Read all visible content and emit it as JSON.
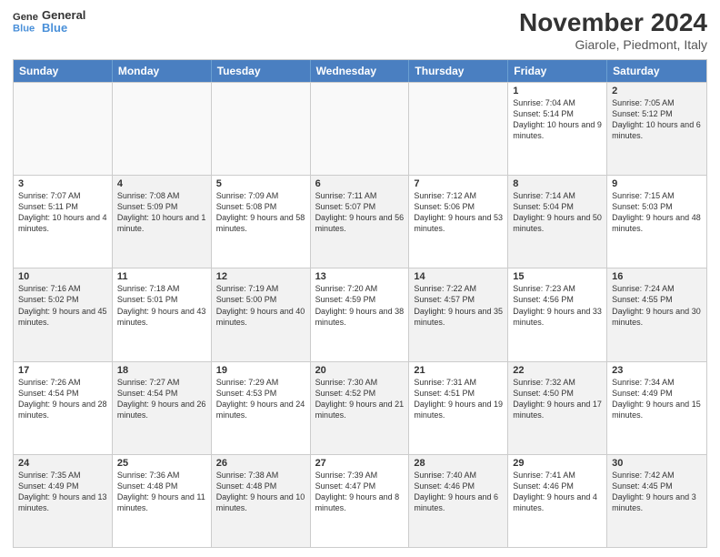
{
  "logo": {
    "line1": "General",
    "line2": "Blue"
  },
  "title": "November 2024",
  "subtitle": "Giarole, Piedmont, Italy",
  "days": [
    "Sunday",
    "Monday",
    "Tuesday",
    "Wednesday",
    "Thursday",
    "Friday",
    "Saturday"
  ],
  "weeks": [
    [
      {
        "day": "",
        "info": "",
        "empty": true
      },
      {
        "day": "",
        "info": "",
        "empty": true
      },
      {
        "day": "",
        "info": "",
        "empty": true
      },
      {
        "day": "",
        "info": "",
        "empty": true
      },
      {
        "day": "",
        "info": "",
        "empty": true
      },
      {
        "day": "1",
        "info": "Sunrise: 7:04 AM\nSunset: 5:14 PM\nDaylight: 10 hours\nand 9 minutes."
      },
      {
        "day": "2",
        "info": "Sunrise: 7:05 AM\nSunset: 5:12 PM\nDaylight: 10 hours\nand 6 minutes.",
        "shaded": true
      }
    ],
    [
      {
        "day": "3",
        "info": "Sunrise: 7:07 AM\nSunset: 5:11 PM\nDaylight: 10 hours\nand 4 minutes."
      },
      {
        "day": "4",
        "info": "Sunrise: 7:08 AM\nSunset: 5:09 PM\nDaylight: 10 hours\nand 1 minute.",
        "shaded": true
      },
      {
        "day": "5",
        "info": "Sunrise: 7:09 AM\nSunset: 5:08 PM\nDaylight: 9 hours\nand 58 minutes."
      },
      {
        "day": "6",
        "info": "Sunrise: 7:11 AM\nSunset: 5:07 PM\nDaylight: 9 hours\nand 56 minutes.",
        "shaded": true
      },
      {
        "day": "7",
        "info": "Sunrise: 7:12 AM\nSunset: 5:06 PM\nDaylight: 9 hours\nand 53 minutes."
      },
      {
        "day": "8",
        "info": "Sunrise: 7:14 AM\nSunset: 5:04 PM\nDaylight: 9 hours\nand 50 minutes.",
        "shaded": true
      },
      {
        "day": "9",
        "info": "Sunrise: 7:15 AM\nSunset: 5:03 PM\nDaylight: 9 hours\nand 48 minutes."
      }
    ],
    [
      {
        "day": "10",
        "info": "Sunrise: 7:16 AM\nSunset: 5:02 PM\nDaylight: 9 hours\nand 45 minutes.",
        "shaded": true
      },
      {
        "day": "11",
        "info": "Sunrise: 7:18 AM\nSunset: 5:01 PM\nDaylight: 9 hours\nand 43 minutes."
      },
      {
        "day": "12",
        "info": "Sunrise: 7:19 AM\nSunset: 5:00 PM\nDaylight: 9 hours\nand 40 minutes.",
        "shaded": true
      },
      {
        "day": "13",
        "info": "Sunrise: 7:20 AM\nSunset: 4:59 PM\nDaylight: 9 hours\nand 38 minutes."
      },
      {
        "day": "14",
        "info": "Sunrise: 7:22 AM\nSunset: 4:57 PM\nDaylight: 9 hours\nand 35 minutes.",
        "shaded": true
      },
      {
        "day": "15",
        "info": "Sunrise: 7:23 AM\nSunset: 4:56 PM\nDaylight: 9 hours\nand 33 minutes."
      },
      {
        "day": "16",
        "info": "Sunrise: 7:24 AM\nSunset: 4:55 PM\nDaylight: 9 hours\nand 30 minutes.",
        "shaded": true
      }
    ],
    [
      {
        "day": "17",
        "info": "Sunrise: 7:26 AM\nSunset: 4:54 PM\nDaylight: 9 hours\nand 28 minutes."
      },
      {
        "day": "18",
        "info": "Sunrise: 7:27 AM\nSunset: 4:54 PM\nDaylight: 9 hours\nand 26 minutes.",
        "shaded": true
      },
      {
        "day": "19",
        "info": "Sunrise: 7:29 AM\nSunset: 4:53 PM\nDaylight: 9 hours\nand 24 minutes."
      },
      {
        "day": "20",
        "info": "Sunrise: 7:30 AM\nSunset: 4:52 PM\nDaylight: 9 hours\nand 21 minutes.",
        "shaded": true
      },
      {
        "day": "21",
        "info": "Sunrise: 7:31 AM\nSunset: 4:51 PM\nDaylight: 9 hours\nand 19 minutes."
      },
      {
        "day": "22",
        "info": "Sunrise: 7:32 AM\nSunset: 4:50 PM\nDaylight: 9 hours\nand 17 minutes.",
        "shaded": true
      },
      {
        "day": "23",
        "info": "Sunrise: 7:34 AM\nSunset: 4:49 PM\nDaylight: 9 hours\nand 15 minutes."
      }
    ],
    [
      {
        "day": "24",
        "info": "Sunrise: 7:35 AM\nSunset: 4:49 PM\nDaylight: 9 hours\nand 13 minutes.",
        "shaded": true
      },
      {
        "day": "25",
        "info": "Sunrise: 7:36 AM\nSunset: 4:48 PM\nDaylight: 9 hours\nand 11 minutes."
      },
      {
        "day": "26",
        "info": "Sunrise: 7:38 AM\nSunset: 4:48 PM\nDaylight: 9 hours\nand 10 minutes.",
        "shaded": true
      },
      {
        "day": "27",
        "info": "Sunrise: 7:39 AM\nSunset: 4:47 PM\nDaylight: 9 hours\nand 8 minutes."
      },
      {
        "day": "28",
        "info": "Sunrise: 7:40 AM\nSunset: 4:46 PM\nDaylight: 9 hours\nand 6 minutes.",
        "shaded": true
      },
      {
        "day": "29",
        "info": "Sunrise: 7:41 AM\nSunset: 4:46 PM\nDaylight: 9 hours\nand 4 minutes."
      },
      {
        "day": "30",
        "info": "Sunrise: 7:42 AM\nSunset: 4:45 PM\nDaylight: 9 hours\nand 3 minutes.",
        "shaded": true
      }
    ]
  ]
}
